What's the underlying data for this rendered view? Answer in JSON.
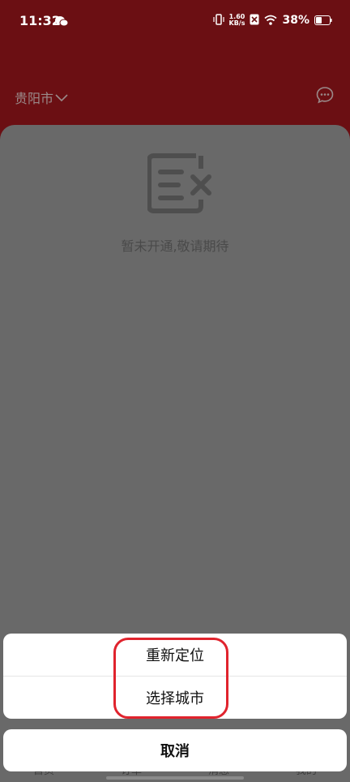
{
  "status_bar": {
    "time": "11:32",
    "net_speed_value": "1.60",
    "net_speed_unit": "KB/s",
    "battery": "38%"
  },
  "header": {
    "city": "贵阳市"
  },
  "content": {
    "empty_message": "暂未开通,敬请期待"
  },
  "tabbar": {
    "items": [
      "首页",
      "订单",
      "消息",
      "我的"
    ]
  },
  "action_sheet": {
    "options": [
      "重新定位",
      "选择城市"
    ],
    "cancel": "取消"
  },
  "colors": {
    "header_bg": "#6b0f13",
    "overlay": "#696969",
    "highlight": "#e0232d"
  }
}
